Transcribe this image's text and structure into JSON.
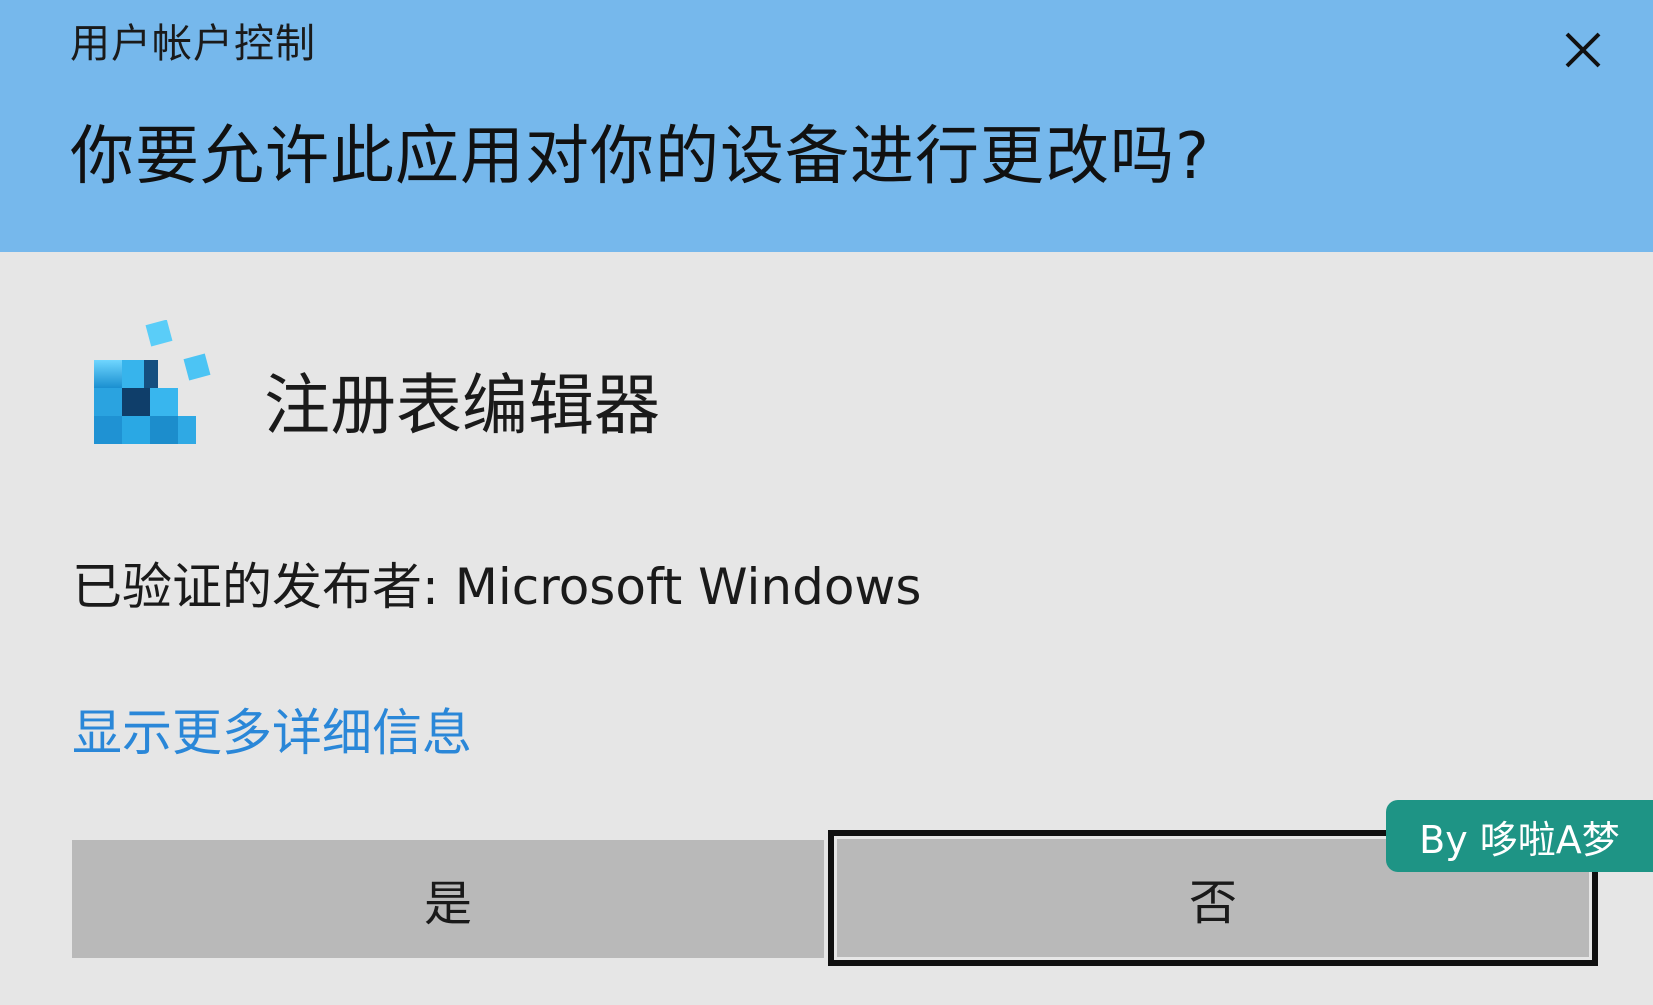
{
  "dialog": {
    "title": "用户帐户控制",
    "question": "你要允许此应用对你的设备进行更改吗?",
    "close_icon": "close-icon",
    "header_color": "#76b8ec",
    "background_color": "#e6e6e6"
  },
  "app": {
    "icon": "registry-editor-icon",
    "name": "注册表编辑器"
  },
  "publisher": {
    "text": "已验证的发布者: Microsoft Windows"
  },
  "details_link": {
    "label": "显示更多详细信息",
    "color": "#2a87d8"
  },
  "buttons": {
    "yes_label": "是",
    "no_label": "否"
  },
  "watermark": {
    "text": "By 哆啦A梦",
    "color": "#1e9485"
  }
}
